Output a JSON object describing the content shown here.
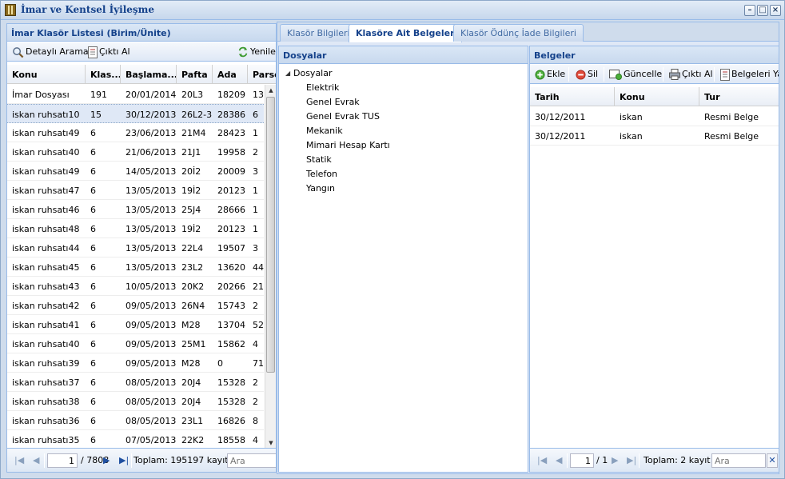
{
  "window": {
    "title": "İmar ve Kentsel İyileşme",
    "minimize_glyph": "–",
    "maximize_glyph": "□",
    "close_glyph": "×"
  },
  "left_panel": {
    "title": "İmar Klasör Listesi (Birim/Ünite)",
    "toolbar": {
      "search_label": "Detaylı Arama",
      "print_label": "Çıktı Al",
      "refresh_label": "Yenile"
    },
    "columns": [
      "Konu",
      "Klas...",
      "Başlama...",
      "Pafta",
      "Ada",
      "Parse"
    ],
    "rows": [
      [
        "İmar Dosyası",
        "191",
        "20/01/2014",
        "20L3",
        "18209",
        "13"
      ],
      [
        "iskan ruhsatı10",
        "15",
        "30/12/2013",
        "26L2-3",
        "28386",
        "6"
      ],
      [
        "iskan ruhsatı49",
        "6",
        "23/06/2013",
        "21M4",
        "28423",
        "1"
      ],
      [
        "iskan ruhsatı40",
        "6",
        "21/06/2013",
        "21J1",
        "19958",
        "2"
      ],
      [
        "iskan ruhsatı49",
        "6",
        "14/05/2013",
        "20İ2",
        "20009",
        "3"
      ],
      [
        "iskan ruhsatı47",
        "6",
        "13/05/2013",
        "19İ2",
        "20123",
        "1"
      ],
      [
        "iskan ruhsatı46",
        "6",
        "13/05/2013",
        "25J4",
        "28666",
        "1"
      ],
      [
        "iskan ruhsatı48",
        "6",
        "13/05/2013",
        "19İ2",
        "20123",
        "1"
      ],
      [
        "iskan ruhsatı44",
        "6",
        "13/05/2013",
        "22L4",
        "19507",
        "3"
      ],
      [
        "iskan ruhsatı45",
        "6",
        "13/05/2013",
        "23L2",
        "13620",
        "44"
      ],
      [
        "iskan ruhsatı43",
        "6",
        "10/05/2013",
        "20K2",
        "20266",
        "21"
      ],
      [
        "iskan ruhsatı42",
        "6",
        "09/05/2013",
        "26N4",
        "15743",
        "2"
      ],
      [
        "iskan ruhsatı41",
        "6",
        "09/05/2013",
        "M28",
        "13704",
        "52"
      ],
      [
        "iskan ruhsatı40",
        "6",
        "09/05/2013",
        "25M1",
        "15862",
        "4"
      ],
      [
        "iskan ruhsatı39",
        "6",
        "09/05/2013",
        "M28",
        "0",
        "71"
      ],
      [
        "iskan ruhsatı37",
        "6",
        "08/05/2013",
        "20J4",
        "15328",
        "2"
      ],
      [
        "iskan ruhsatı38",
        "6",
        "08/05/2013",
        "20J4",
        "15328",
        "2"
      ],
      [
        "iskan ruhsatı36",
        "6",
        "08/05/2013",
        "23L1",
        "16826",
        "8"
      ],
      [
        "iskan ruhsatı35",
        "6",
        "07/05/2013",
        "22K2",
        "18558",
        "4"
      ]
    ],
    "selected_row_index": 1,
    "pager": {
      "page_value": "1",
      "total_pages": "/ 7808",
      "total_text": "Toplam: 195197 kayıt",
      "search_placeholder": "Ara"
    }
  },
  "tabs": [
    {
      "label": "Klasör Bilgileri"
    },
    {
      "label": "Klasöre Ait Belgeler"
    },
    {
      "label": "Klasör Ödünç İade Bilgileri"
    }
  ],
  "active_tab_index": 1,
  "dosyalar": {
    "title": "Dosyalar",
    "root": "Dosyalar",
    "children": [
      "Elektrik",
      "Genel Evrak",
      "Genel Evrak TUS",
      "Mekanik",
      "Mimari Hesap Kartı",
      "Statik",
      "Telefon",
      "Yangın"
    ]
  },
  "belgeler": {
    "title": "Belgeler",
    "toolbar": {
      "add_label": "Ekle",
      "delete_label": "Sil",
      "update_label": "Güncelle",
      "print_label": "Çıktı Al",
      "upload_label": "Belgeleri Ya"
    },
    "columns": [
      "Tarih",
      "Konu",
      "Tur"
    ],
    "rows": [
      [
        "30/12/2011",
        "iskan",
        "Resmi Belge"
      ],
      [
        "30/12/2011",
        "iskan",
        "Resmi Belge"
      ]
    ],
    "pager": {
      "page_value": "1",
      "total_pages": "/ 1",
      "total_text": "Toplam: 2 kayıt",
      "search_placeholder": "Ara",
      "clear_glyph": "✕"
    }
  }
}
